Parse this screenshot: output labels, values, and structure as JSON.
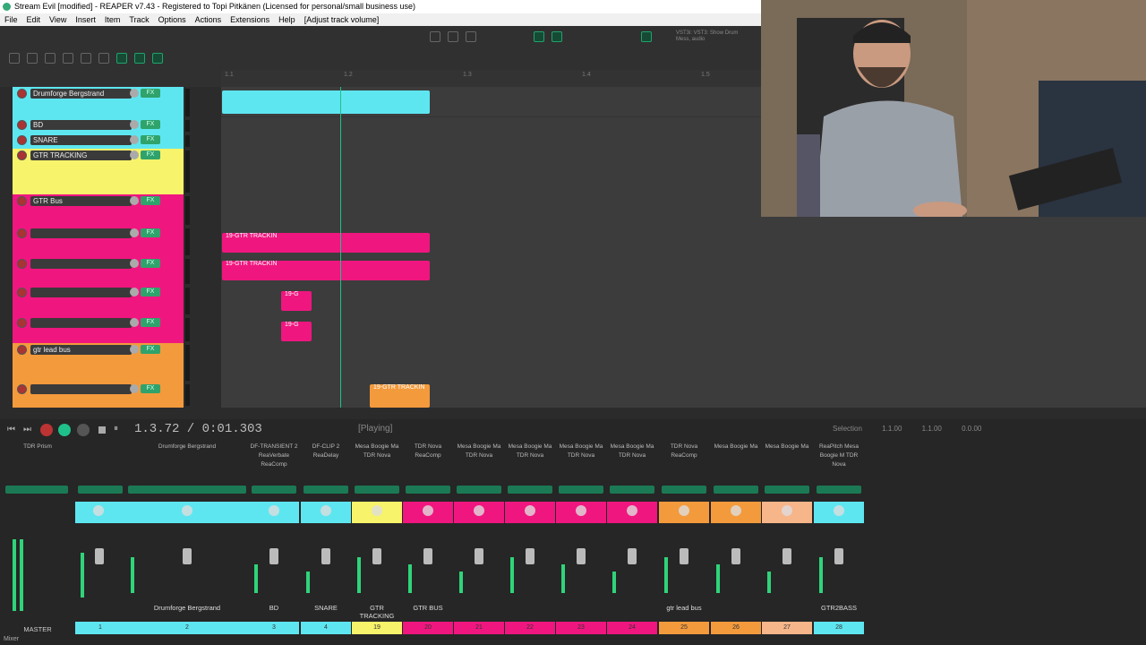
{
  "window": {
    "title": "Stream Evil [modified] - REAPER v7.43 - Registered to Topi Pitkänen (Licensed for personal/small business use)"
  },
  "menu": [
    "File",
    "Edit",
    "View",
    "Insert",
    "Item",
    "Track",
    "Options",
    "Actions",
    "Extensions",
    "Help",
    "[Adjust track volume]"
  ],
  "toolbar": {
    "plugin_hint": "VST3i: VST3: Show Drum Mess, audio"
  },
  "ruler": {
    "ticks": [
      "1.1",
      "1.2",
      "1.3",
      "1.4",
      "1.5"
    ]
  },
  "tracks": [
    {
      "name": "Drumforge Bergstrand",
      "color": "#5ee6f0"
    },
    {
      "name": "BD",
      "color": "#5ee6f0"
    },
    {
      "name": "SNARE",
      "color": "#5ee6f0"
    },
    {
      "name": "GTR TRACKING",
      "color": "#f7f36a"
    },
    {
      "name": "GTR Bus",
      "color": "#f0167f"
    },
    {
      "name": "",
      "color": "#f0167f"
    },
    {
      "name": "",
      "color": "#f0167f"
    },
    {
      "name": "",
      "color": "#f0167f"
    },
    {
      "name": "",
      "color": "#f0167f"
    },
    {
      "name": "gtr lead bus",
      "color": "#f39a3c"
    },
    {
      "name": "",
      "color": "#f39a3c"
    }
  ],
  "items": {
    "gtr_label": "19-GTR TRACKIN",
    "gtr_short": "19-G"
  },
  "transport": {
    "time": "1.3.72 / 0:01.303",
    "status": "[Playing]",
    "selection_label": "Selection",
    "sel_start": "1.1.00",
    "sel_end": "1.1.00",
    "sel_len": "0.0.00"
  },
  "mixer": {
    "master_label": "MASTER",
    "master_plug": "TDR Prism",
    "strips": [
      {
        "name": "Drumforge Bergstrand",
        "plug": "Drumforge Bergstrand",
        "num": "2",
        "color": "#5ee6f0"
      },
      {
        "name": "BD",
        "plug": "DF-TRANSIENT 2 ReaVerbate ReaComp",
        "num": "3",
        "color": "#5ee6f0"
      },
      {
        "name": "SNARE",
        "plug": "DF-CLIP 2 ReaDelay",
        "num": "4",
        "color": "#5ee6f0"
      },
      {
        "name": "GTR TRACKING",
        "plug": "Mesa Boogie Ma TDR Nova",
        "num": "19",
        "color": "#f7f36a"
      },
      {
        "name": "GTR BUS",
        "plug": "TDR Nova ReaComp",
        "num": "20",
        "color": "#f0167f"
      },
      {
        "name": "",
        "plug": "Mesa Boogie Ma TDR Nova",
        "num": "21",
        "color": "#f0167f"
      },
      {
        "name": "",
        "plug": "Mesa Boogie Ma TDR Nova",
        "num": "22",
        "color": "#f0167f"
      },
      {
        "name": "",
        "plug": "Mesa Boogie Ma TDR Nova",
        "num": "23",
        "color": "#f0167f"
      },
      {
        "name": "",
        "plug": "Mesa Boogie Ma TDR Nova",
        "num": "24",
        "color": "#f0167f"
      },
      {
        "name": "gtr lead bus",
        "plug": "TDR Nova ReaComp",
        "num": "25",
        "color": "#f39a3c"
      },
      {
        "name": "",
        "plug": "Mesa Boogie Ma",
        "num": "26",
        "color": "#f39a3c"
      },
      {
        "name": "",
        "plug": "Mesa Boogie Ma",
        "num": "27",
        "color": "#f7b58a"
      },
      {
        "name": "GTR2BASS",
        "plug": "ReaPitch Mesa Boogie M TDR Nova",
        "num": "28",
        "color": "#5ee6f0"
      }
    ],
    "first_num": "1"
  },
  "footer": {
    "mixer_tab": "Mixer"
  }
}
